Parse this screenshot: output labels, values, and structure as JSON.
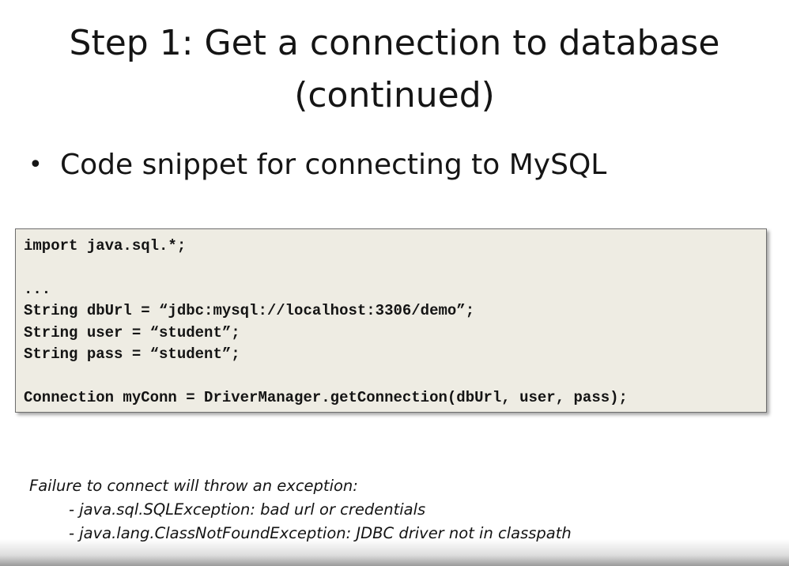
{
  "slide": {
    "title_line1": "Step 1: Get a connection to database",
    "title_line2": "(continued)",
    "bullet_symbol": "•",
    "bullet_text": "Code snippet for connecting to MySQL"
  },
  "code": {
    "lines": [
      "import java.sql.*;",
      "",
      "...",
      "String dbUrl = “jdbc:mysql://localhost:3306/demo”;",
      "String user = “student”;",
      "String pass = “student”;",
      "",
      "Connection myConn = DriverManager.getConnection(dbUrl, user, pass);"
    ]
  },
  "notes": {
    "heading": "Failure to connect will throw an exception:",
    "items": [
      "- java.sql.SQLException:  bad url or credentials",
      "- java.lang.ClassNotFoundException:  JDBC driver not in classpath"
    ]
  },
  "colors": {
    "code_background": "#eeece3",
    "code_border": "#6e6e6e",
    "text": "#151515"
  }
}
